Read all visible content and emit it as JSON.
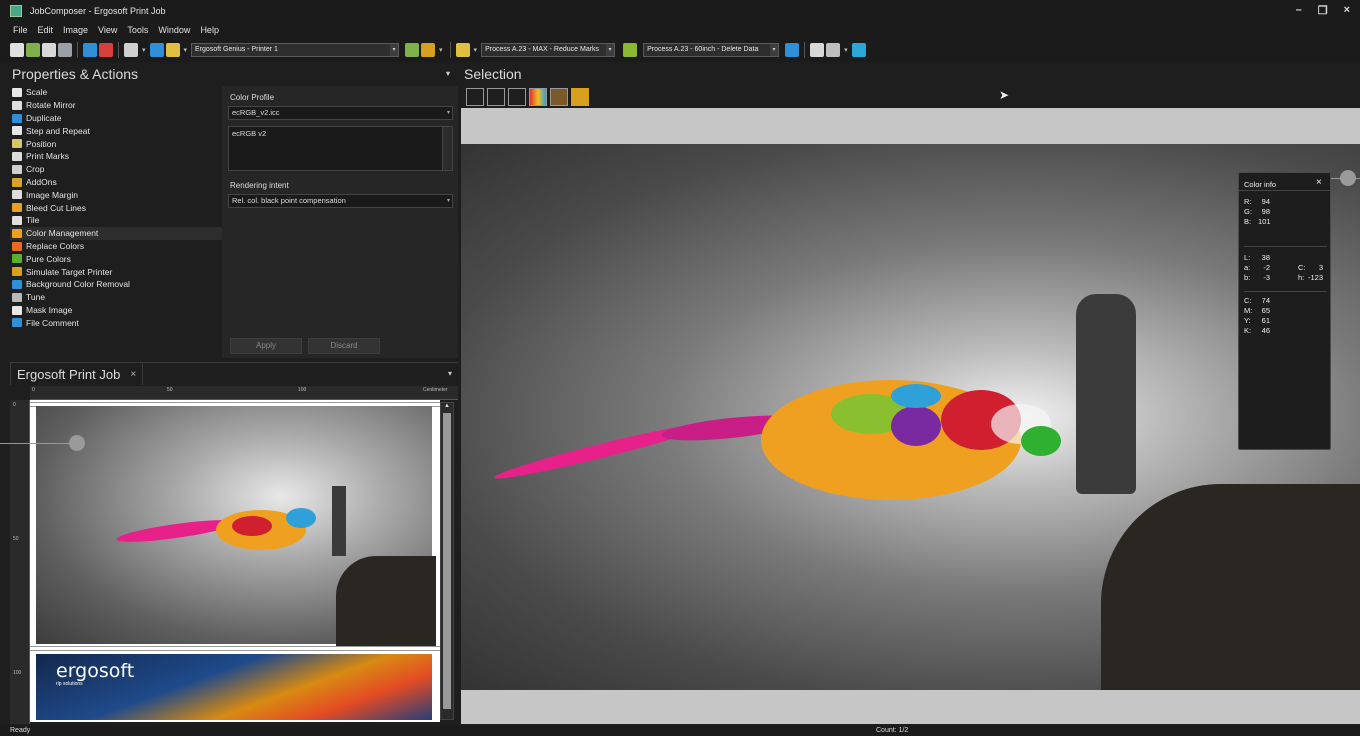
{
  "window": {
    "title": "JobComposer - Ergosoft Print Job",
    "minimize": "–",
    "restore": "❐",
    "close": "×"
  },
  "menu": [
    "File",
    "Edit",
    "Image",
    "View",
    "Tools",
    "Window",
    "Help"
  ],
  "toolbar": {
    "printer": "Ergosoft Genius - Printer 1",
    "process1": "Process A.23 - MAX - Reduce Marks",
    "process2": "Process A.23 - 60inch - Delete Data"
  },
  "properties": {
    "title": "Properties & Actions",
    "actions": [
      {
        "label": "Scale",
        "color": "#e8e8e8"
      },
      {
        "label": "Rotate Mirror",
        "color": "#e0e0e0"
      },
      {
        "label": "Duplicate",
        "color": "#2f8fd8"
      },
      {
        "label": "Step and Repeat",
        "color": "#e6e6e6"
      },
      {
        "label": "Position",
        "color": "#d9c46a"
      },
      {
        "label": "Print Marks",
        "color": "#dcdcdc"
      },
      {
        "label": "Crop",
        "color": "#cfcfcf"
      },
      {
        "label": "AddOns",
        "color": "#d9a32a"
      },
      {
        "label": "Image Margin",
        "color": "#dcdcdc"
      },
      {
        "label": "Bleed Cut Lines",
        "color": "#e8a020"
      },
      {
        "label": "Tile",
        "color": "#e0e0e0"
      },
      {
        "label": "Color Management",
        "color": "#f0a020"
      },
      {
        "label": "Replace Colors",
        "color": "#e86a20"
      },
      {
        "label": "Pure Colors",
        "color": "#59b030"
      },
      {
        "label": "Simulate Target Printer",
        "color": "#d8a020"
      },
      {
        "label": "Background Color Removal",
        "color": "#2f8fd8"
      },
      {
        "label": "Tune",
        "color": "#b9b9b9"
      },
      {
        "label": "Mask Image",
        "color": "#e8e8e8"
      },
      {
        "label": "File Comment",
        "color": "#2f8fd8"
      }
    ],
    "selected_index": 11
  },
  "color_panel": {
    "profile_label": "Color Profile",
    "profile_value": "ecRGB_v2.icc",
    "profile_desc": "ecRGB v2",
    "intent_label": "Rendering intent",
    "intent_value": "Rel. col. black point compensation",
    "apply": "Apply",
    "discard": "Discard"
  },
  "job": {
    "tab": "Ergosoft Print Job",
    "close": "×",
    "ruler_top": [
      "0",
      "50",
      "100",
      "Centimeter"
    ],
    "ruler_left": [
      "0",
      "50",
      "100"
    ],
    "brand": "ergosoft",
    "brand_sub": "rip solutions"
  },
  "selection": {
    "title": "Selection",
    "chevron": "▾"
  },
  "color_info": {
    "title": "Color info",
    "close": "×",
    "rgb": [
      {
        "k": "R:",
        "v": "94"
      },
      {
        "k": "G:",
        "v": "98"
      },
      {
        "k": "B:",
        "v": "101"
      }
    ],
    "lab": [
      {
        "k": "L:",
        "v": "38",
        "k2": "",
        "v2": ""
      },
      {
        "k": "a:",
        "v": "-2",
        "k2": "C:",
        "v2": "3"
      },
      {
        "k": "b:",
        "v": "-3",
        "k2": "h:",
        "v2": "-123"
      }
    ],
    "cmyk": [
      {
        "k": "C:",
        "v": "74"
      },
      {
        "k": "M:",
        "v": "65"
      },
      {
        "k": "Y:",
        "v": "61"
      },
      {
        "k": "K:",
        "v": "46"
      }
    ]
  },
  "status": {
    "left": "Ready",
    "count": "Count: 1/2"
  }
}
